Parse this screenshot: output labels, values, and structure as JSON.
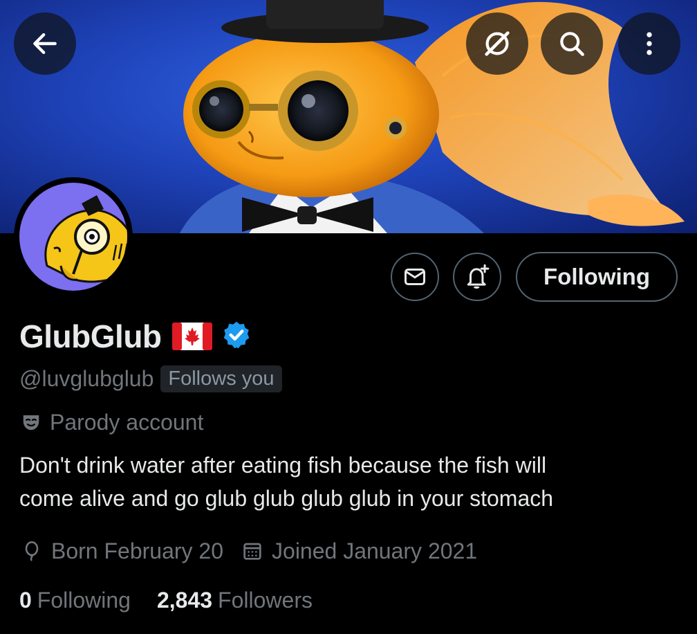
{
  "profile": {
    "display_name": "GlubGlub",
    "flag_icon": "canada-flag-icon",
    "verified_icon": "verified-badge-icon",
    "handle": "@luvglubglub",
    "follows_you": "Follows you",
    "parody_label": "Parody account",
    "bio_line1": "Don't drink water after eating fish because the fish will",
    "bio_line2": "come alive and go glub glub glub glub in your stomach",
    "birthday": "Born February 20",
    "joined": "Joined January 2021",
    "following_count": "0",
    "following_label": "Following",
    "followers_count": "2,843",
    "followers_label": "Followers"
  },
  "header": {
    "back_icon": "arrow-left-icon",
    "grok_icon": "grok-icon",
    "search_icon": "search-icon",
    "more_icon": "more-vertical-icon"
  },
  "actions": {
    "message_icon": "envelope-icon",
    "notify_icon": "bell-plus-icon",
    "follow_button_label": "Following"
  },
  "colors": {
    "background": "#000000",
    "primary_text": "#e7e9ea",
    "secondary_text": "#71767b",
    "verified_blue": "#1d9bf0",
    "border": "#536471"
  }
}
